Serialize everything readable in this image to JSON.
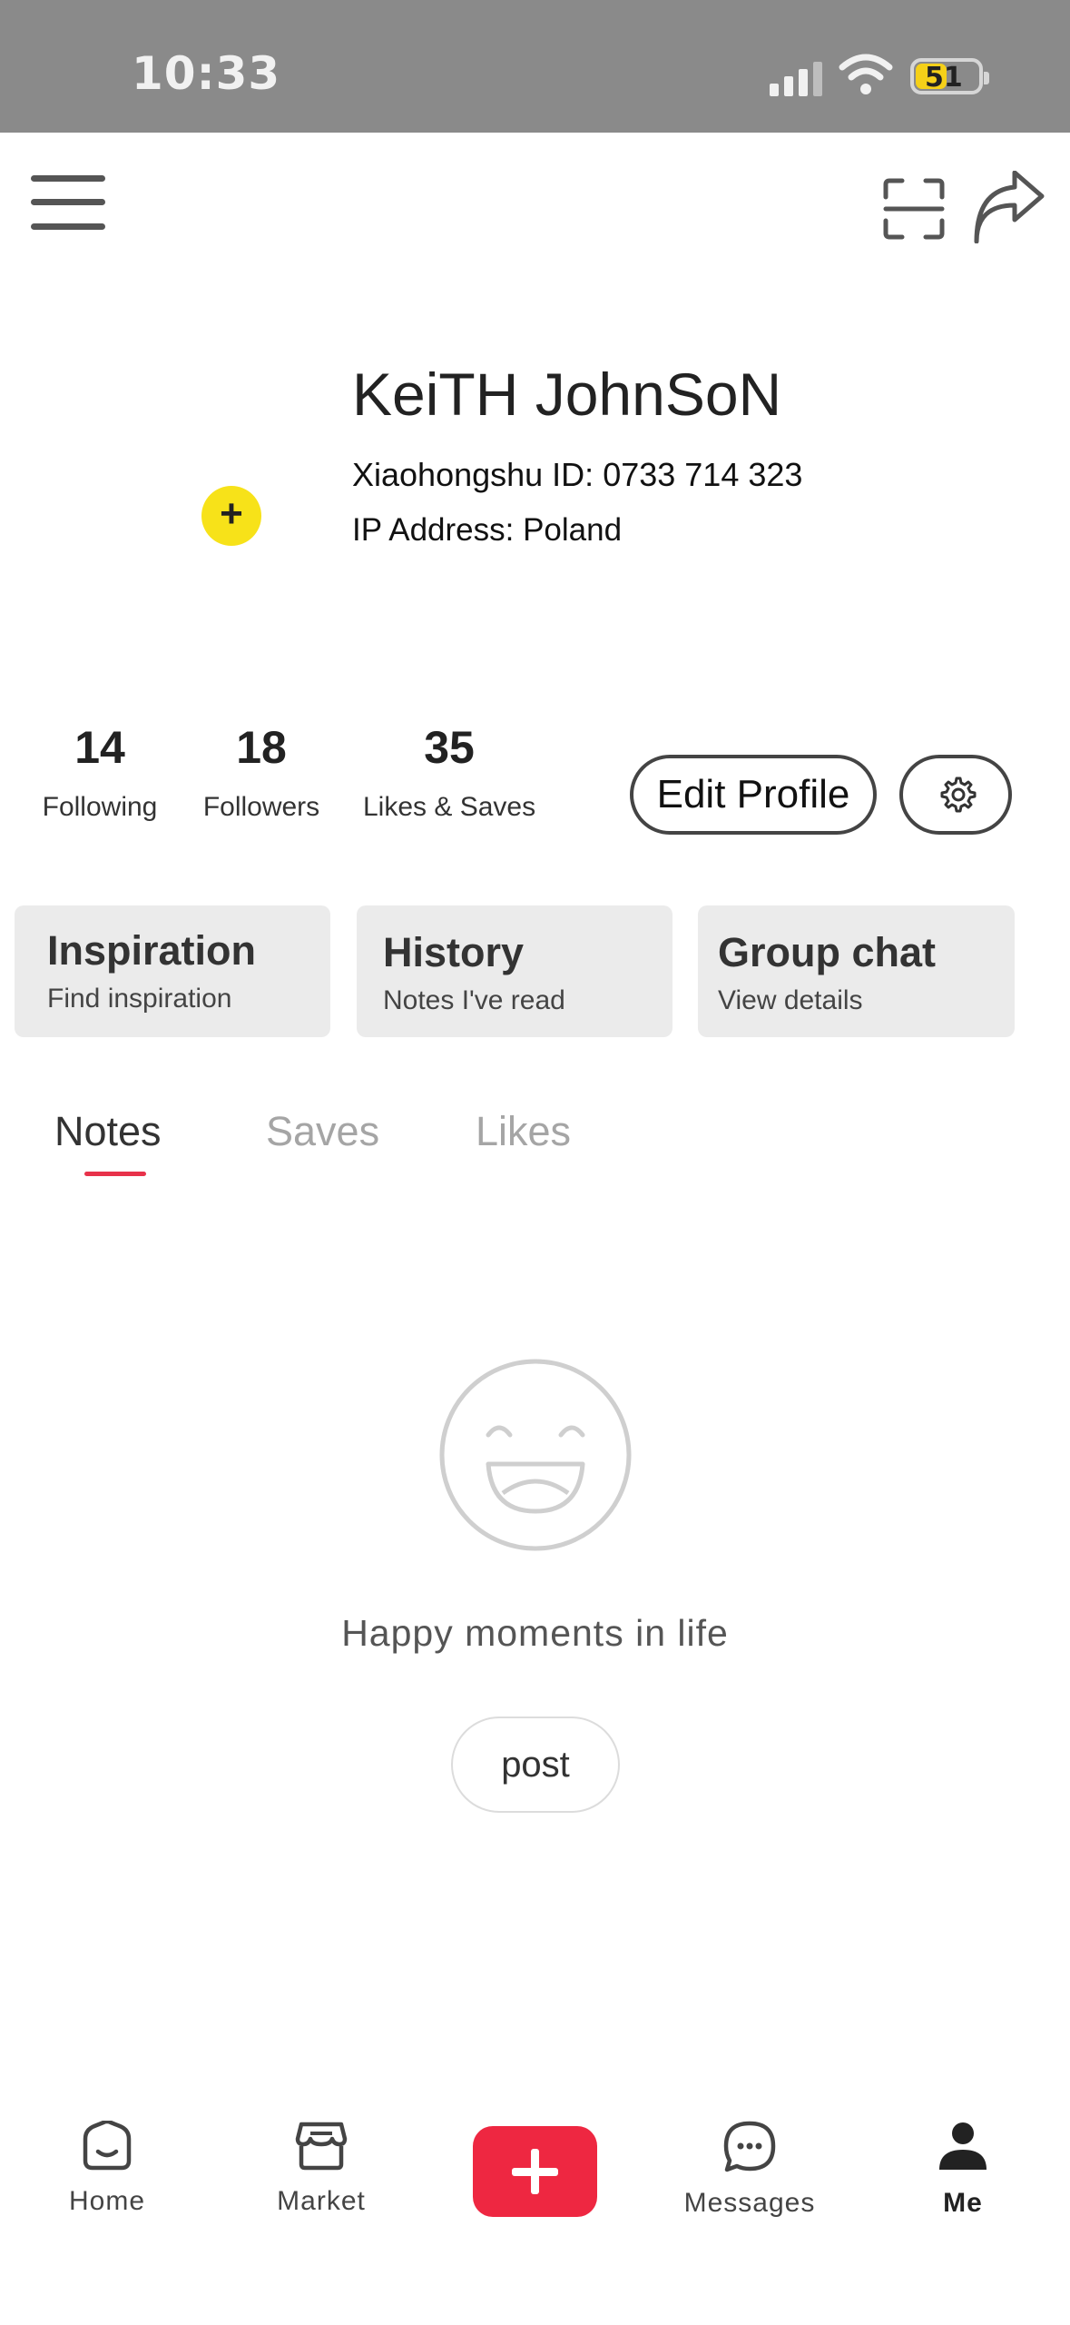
{
  "status_bar": {
    "time": "10:33",
    "battery": "51",
    "battery_level": 0.51
  },
  "profile": {
    "name": "KeiTH JohnSoN",
    "id_line": "Xiaohongshu ID: 0733 714 323",
    "ip_line": "IP Address: Poland",
    "add_badge": "+"
  },
  "stats": [
    {
      "value": "14",
      "label": "Following"
    },
    {
      "value": "18",
      "label": "Followers"
    },
    {
      "value": "35",
      "label": "Likes & Saves"
    }
  ],
  "actions": {
    "edit_profile": "Edit Profile"
  },
  "cards": [
    {
      "title": "Inspiration",
      "subtitle": "Find inspiration"
    },
    {
      "title": "History",
      "subtitle": "Notes I've read"
    },
    {
      "title": "Group chat",
      "subtitle": "View details"
    }
  ],
  "tabs": [
    {
      "label": "Notes",
      "active": true
    },
    {
      "label": "Saves",
      "active": false
    },
    {
      "label": "Likes",
      "active": false
    }
  ],
  "empty_state": {
    "message": "Happy moments in life",
    "button": "post"
  },
  "bottom_nav": [
    {
      "label": "Home",
      "icon": "home-icon"
    },
    {
      "label": "Market",
      "icon": "market-icon"
    },
    {
      "label": "",
      "icon": "plus-icon"
    },
    {
      "label": "Messages",
      "icon": "chat-icon"
    },
    {
      "label": "Me",
      "icon": "person-icon"
    }
  ],
  "colors": {
    "accent": "#ee2741",
    "badge": "#f7e219",
    "status_bar": "#8a8a8a",
    "card_bg": "#ebebeb"
  }
}
